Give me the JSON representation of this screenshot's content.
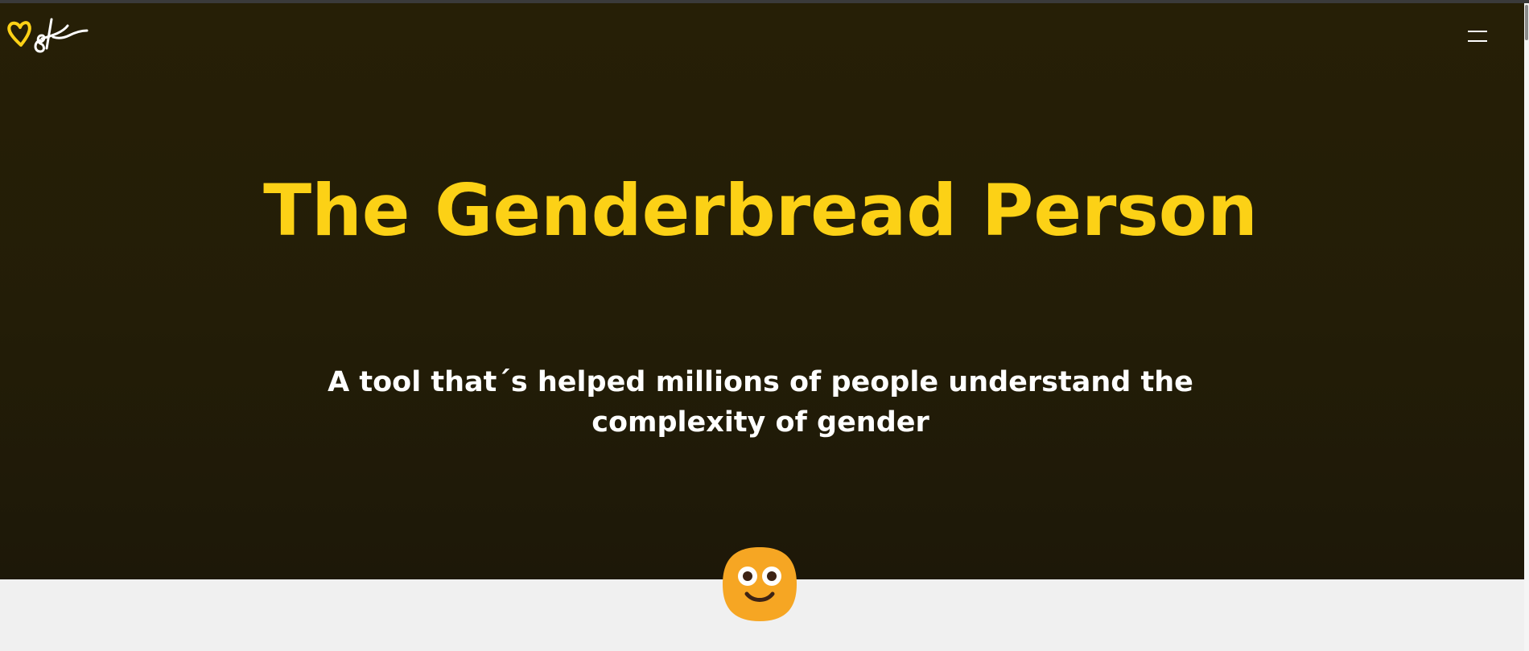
{
  "header": {
    "logo_icon": "heart-signature-logo",
    "menu_icon": "hamburger-menu-icon"
  },
  "hero": {
    "title": "The Genderbread Person",
    "subtitle": "A tool that´s helped millions of people understand the complexity of gender"
  },
  "mascot_icon": "smiling-face-icon",
  "colors": {
    "hero_background": "#241e07",
    "title": "#fcd116",
    "subtitle": "#ffffff",
    "page_background": "#f0f0f0",
    "mascot": "#f6a623",
    "mascot_features": "#3d2314"
  }
}
